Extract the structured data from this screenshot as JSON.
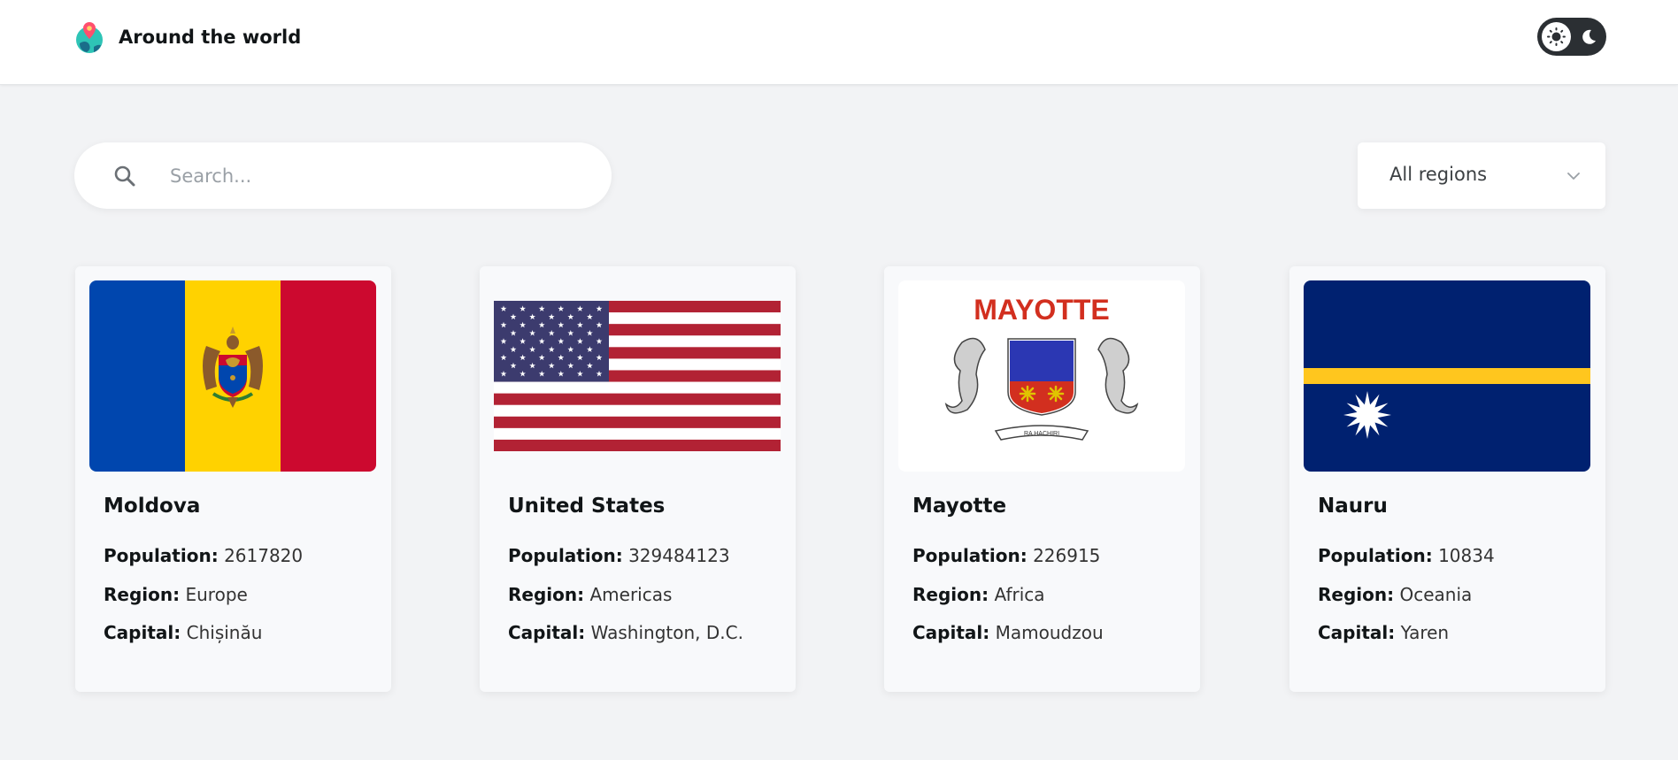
{
  "header": {
    "title": "Around the world",
    "logo_icon": "globe-pin-icon",
    "theme_toggle": {
      "light_icon": "sun-icon",
      "dark_icon": "moon-icon"
    }
  },
  "search": {
    "placeholder": "Search...",
    "value": "",
    "icon": "search-icon"
  },
  "region_filter": {
    "selected": "All regions",
    "icon": "chevron-down-icon"
  },
  "labels": {
    "population": "Population:",
    "region": "Region:",
    "capital": "Capital:"
  },
  "countries": [
    {
      "name": "Moldova",
      "population": "2617820",
      "region": "Europe",
      "capital": "Chișinău",
      "flag": "moldova-flag"
    },
    {
      "name": "United States",
      "population": "329484123",
      "region": "Americas",
      "capital": "Washington, D.C.",
      "flag": "us-flag"
    },
    {
      "name": "Mayotte",
      "population": "226915",
      "region": "Africa",
      "capital": "Mamoudzou",
      "flag": "mayotte-flag",
      "flag_text": "MAYOTTE",
      "flag_motto": "RA HACHIRI"
    },
    {
      "name": "Nauru",
      "population": "10834",
      "region": "Oceania",
      "capital": "Yaren",
      "flag": "nauru-flag"
    }
  ],
  "colors": {
    "background": "#f2f3f5",
    "card": "#f8f9fb",
    "text": "#111517",
    "toggle": "#2b2f33"
  }
}
